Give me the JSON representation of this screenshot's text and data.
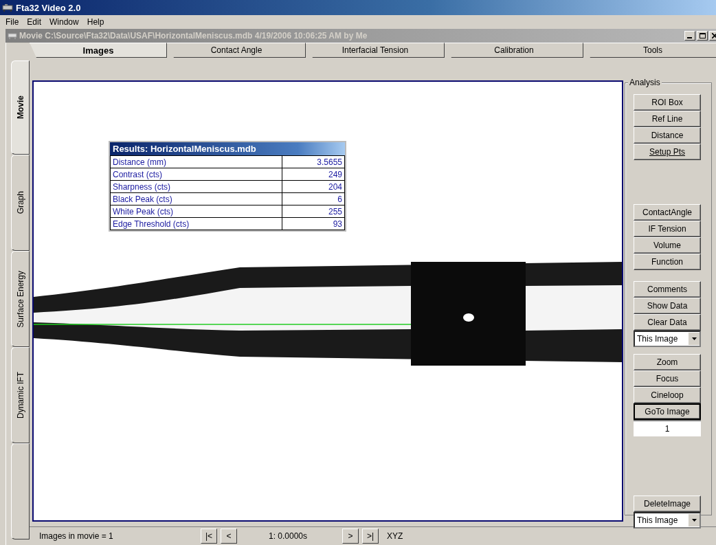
{
  "app_title": "Fta32 Video 2.0",
  "menu": [
    "File",
    "Edit",
    "Window",
    "Help"
  ],
  "document_window": {
    "title": "Movie C:\\Source\\Fta32\\Data\\USAF\\HorizontalMeniscus.mdb 4/19/2006 10:06:25 AM  by Me"
  },
  "top_tabs": [
    {
      "label": "Images",
      "selected": true
    },
    {
      "label": "Contact Angle",
      "selected": false
    },
    {
      "label": "Interfacial Tension",
      "selected": false
    },
    {
      "label": "Calibration",
      "selected": false
    },
    {
      "label": "Tools",
      "selected": false
    }
  ],
  "side_tabs": [
    {
      "label": "Movie",
      "selected": true
    },
    {
      "label": "Graph",
      "selected": false
    },
    {
      "label": "Surface Energy",
      "selected": false
    },
    {
      "label": "Dynamic IFT",
      "selected": false
    },
    {
      "selected": false
    }
  ],
  "results": {
    "title": "Results: HorizontalMeniscus.mdb",
    "rows": [
      {
        "label": "Distance (mm)",
        "value": "3.5655"
      },
      {
        "label": "Contrast (cts)",
        "value": "249"
      },
      {
        "label": "Sharpness (cts)",
        "value": "204"
      },
      {
        "label": "Black Peak (cts)",
        "value": "6"
      },
      {
        "label": "White Peak (cts)",
        "value": "255"
      },
      {
        "label": "Edge Threshold (cts)",
        "value": "93"
      }
    ]
  },
  "analysis": {
    "title": "Analysis",
    "groups": [
      {
        "items": [
          {
            "kind": "button",
            "label": "ROI Box",
            "underlined": false,
            "default": false
          },
          {
            "kind": "button",
            "label": "Ref Line",
            "underlined": false,
            "default": false
          },
          {
            "kind": "button",
            "label": "Distance",
            "underlined": false,
            "default": false
          },
          {
            "kind": "button",
            "label": "Setup Pts",
            "underlined": true,
            "default": false
          }
        ]
      },
      {
        "items": [
          {
            "kind": "button",
            "label": "ContactAngle",
            "underlined": false,
            "default": false
          },
          {
            "kind": "button",
            "label": "IF Tension",
            "underlined": false,
            "default": false
          },
          {
            "kind": "button",
            "label": "Volume",
            "underlined": false,
            "default": false
          },
          {
            "kind": "button",
            "label": "Function",
            "underlined": false,
            "default": false
          }
        ]
      },
      {
        "items": [
          {
            "kind": "button",
            "label": "Comments",
            "underlined": false,
            "default": false
          },
          {
            "kind": "button",
            "label": "Show Data",
            "underlined": false,
            "default": false
          },
          {
            "kind": "button",
            "label": "Clear Data",
            "underlined": false,
            "default": false
          },
          {
            "kind": "dropdown",
            "value": "This Image"
          }
        ]
      },
      {
        "items": [
          {
            "kind": "button",
            "label": "Zoom",
            "underlined": false,
            "default": false
          },
          {
            "kind": "button",
            "label": "Focus",
            "underlined": false,
            "default": false
          },
          {
            "kind": "button",
            "label": "Cineloop",
            "underlined": false,
            "default": false
          },
          {
            "kind": "button",
            "label": "GoTo Image",
            "underlined": false,
            "default": true
          },
          {
            "kind": "field",
            "value": "1"
          }
        ]
      },
      {
        "items": [
          {
            "kind": "button",
            "label": "DeleteImage",
            "underlined": false,
            "default": false
          },
          {
            "kind": "dropdown",
            "value": "This Image"
          }
        ]
      }
    ]
  },
  "status_bar": {
    "info": "Images in movie = 1",
    "back_buttons": [
      "|<",
      "<"
    ],
    "frame": "1:  0.0000s",
    "forward_buttons": [
      ">",
      ">|"
    ],
    "label": "XYZ"
  }
}
